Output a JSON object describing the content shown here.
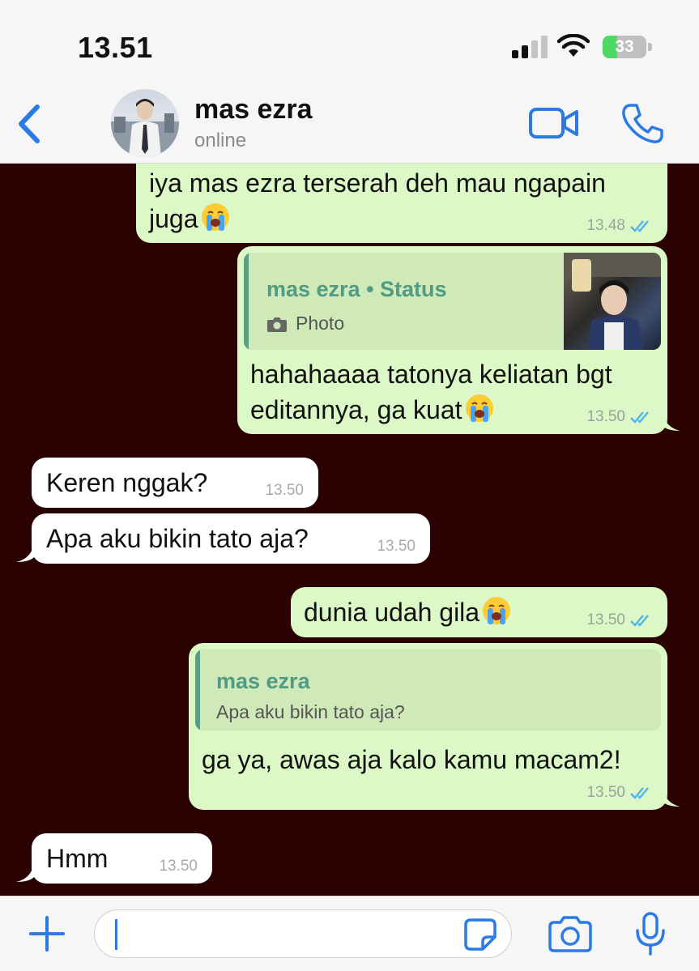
{
  "status_bar": {
    "time": "13.51",
    "battery": "33",
    "battery_level": 0.33
  },
  "header": {
    "contact_name": "mas ezra",
    "contact_status": "online"
  },
  "colors": {
    "accent": "#2c7be5",
    "outgoing_bubble": "#dcf8c6",
    "incoming_bubble": "#ffffff",
    "chat_bg": "#2b0202",
    "quote_title": "#4f9b86"
  },
  "messages": [
    {
      "direction": "out",
      "lines": [
        "iya mas ezra terserah deh mau ngapain",
        "juga"
      ],
      "emoji": "crying-face",
      "time": "13.48",
      "read": true
    },
    {
      "direction": "out",
      "quote": {
        "title": "mas ezra • Status",
        "subtitle": "Photo",
        "icon": "camera-icon",
        "has_thumbnail": true
      },
      "lines": [
        "hahahaaaa tatonya keliatan bgt",
        "editannya, ga kuat"
      ],
      "emoji": "crying-face",
      "time": "13.50",
      "read": true
    },
    {
      "direction": "in",
      "lines": [
        "Keren nggak?"
      ],
      "time": "13.50"
    },
    {
      "direction": "in",
      "lines": [
        "Apa aku bikin tato aja?"
      ],
      "time": "13.50"
    },
    {
      "direction": "out",
      "lines": [
        "dunia udah gila"
      ],
      "emoji": "crying-face",
      "time": "13.50",
      "read": true
    },
    {
      "direction": "out",
      "quote": {
        "title": "mas ezra",
        "subtitle": "Apa aku bikin tato aja?"
      },
      "lines": [
        "ga ya, awas aja kalo kamu macam2!"
      ],
      "time": "13.50",
      "read": true
    },
    {
      "direction": "in",
      "lines": [
        "Hmm"
      ],
      "time": "13.50"
    }
  ],
  "input": {
    "value": "",
    "placeholder": ""
  },
  "icons": [
    "back-chevron-icon",
    "video-call-icon",
    "phone-icon",
    "plus-icon",
    "sticker-icon",
    "camera-icon",
    "microphone-icon"
  ]
}
